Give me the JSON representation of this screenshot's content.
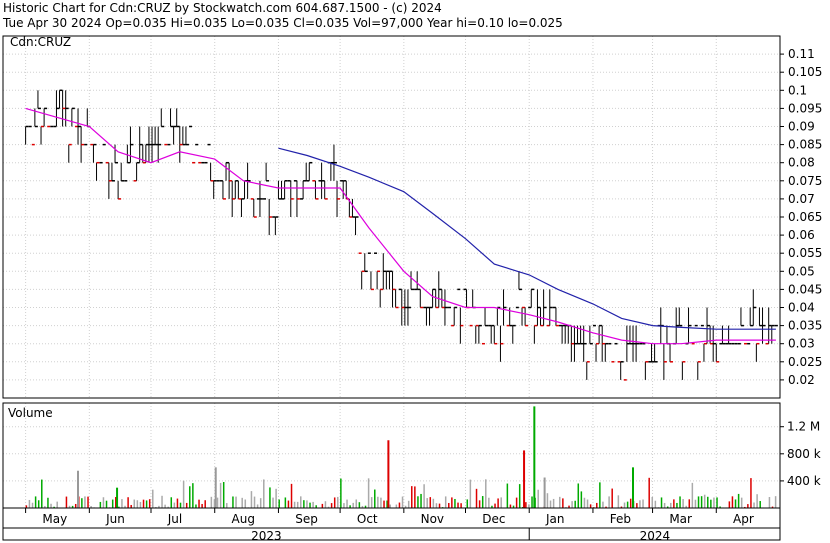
{
  "header": {
    "line1": "Historic Chart for Cdn:CRUZ by Stockwatch.com 604.687.1500 - (c) 2024",
    "line2": "Tue Apr 30 2024  Op=0.035  Hi=0.035  Lo=0.035  Cl=0.035  Vol=97,000  Year hi=0.10  lo=0.025"
  },
  "chart_data": {
    "type": "line",
    "price_panel": {
      "label": "Cdn:CRUZ",
      "ylim": [
        0.015,
        0.115
      ],
      "yticks": [
        "0.11",
        "0.105",
        "0.1",
        "0.095",
        "0.09",
        "0.085",
        "0.08",
        "0.075",
        "0.07",
        "0.065",
        "0.06",
        "0.055",
        "0.05",
        "0.045",
        "0.04",
        "0.035",
        "0.03",
        "0.025",
        "0.02"
      ],
      "close_series": {
        "name": "",
        "x": [
          "2023-05-01",
          "2023-05-15",
          "2023-06-01",
          "2023-06-15",
          "2023-07-01",
          "2023-07-15",
          "2023-08-01",
          "2023-08-15",
          "2023-09-01",
          "2023-09-15",
          "2023-10-01",
          "2023-10-15",
          "2023-11-01",
          "2023-11-15",
          "2023-12-01",
          "2023-12-15",
          "2024-01-01",
          "2024-01-15",
          "2024-02-01",
          "2024-02-15",
          "2024-03-01",
          "2024-03-15",
          "2024-04-01",
          "2024-04-30"
        ],
        "values": [
          0.09,
          0.095,
          0.085,
          0.075,
          0.085,
          0.09,
          0.075,
          0.07,
          0.07,
          0.075,
          0.075,
          0.05,
          0.045,
          0.04,
          0.04,
          0.035,
          0.04,
          0.035,
          0.03,
          0.025,
          0.03,
          0.03,
          0.03,
          0.035
        ]
      },
      "ma_short": {
        "name": "",
        "color": "#dd00dd",
        "x": [
          "2023-05-01",
          "2023-06-01",
          "2023-06-15",
          "2023-07-01",
          "2023-07-15",
          "2023-08-01",
          "2023-08-15",
          "2023-09-01",
          "2023-09-15",
          "2023-10-01",
          "2023-10-15",
          "2023-11-01",
          "2023-11-15",
          "2023-12-01",
          "2023-12-15",
          "2024-01-01",
          "2024-01-15",
          "2024-02-01",
          "2024-02-15",
          "2024-03-01",
          "2024-03-15",
          "2024-04-01",
          "2024-04-30"
        ],
        "values": [
          0.095,
          0.09,
          0.083,
          0.08,
          0.083,
          0.081,
          0.075,
          0.073,
          0.073,
          0.073,
          0.062,
          0.05,
          0.043,
          0.04,
          0.04,
          0.038,
          0.036,
          0.033,
          0.031,
          0.03,
          0.03,
          0.031,
          0.031
        ]
      },
      "ma_long": {
        "name": "",
        "color": "#2222aa",
        "x": [
          "2023-09-01",
          "2023-09-15",
          "2023-10-01",
          "2023-10-15",
          "2023-11-01",
          "2023-11-15",
          "2023-12-01",
          "2023-12-15",
          "2024-01-01",
          "2024-01-15",
          "2024-02-01",
          "2024-02-15",
          "2024-03-01",
          "2024-03-15",
          "2024-04-01",
          "2024-04-30"
        ],
        "values": [
          0.084,
          0.082,
          0.079,
          0.076,
          0.072,
          0.066,
          0.059,
          0.052,
          0.049,
          0.045,
          0.041,
          0.037,
          0.035,
          0.0345,
          0.034,
          0.034
        ]
      }
    },
    "volume_panel": {
      "label": "Volume",
      "ylim": [
        0,
        1550000
      ],
      "yticks": [
        "1.2 M",
        "800 k",
        "400 k"
      ],
      "bars": [
        {
          "x": "2023-10-24",
          "value": 1000000,
          "color": "#dd0000"
        },
        {
          "x": "2023-12-29",
          "value": 850000,
          "color": "#dd0000"
        },
        {
          "x": "2024-01-03",
          "value": 1500000,
          "color": "#00aa00"
        },
        {
          "x": "2024-02-20",
          "value": 600000,
          "color": "#00aa00"
        },
        {
          "x": "2023-08-01",
          "value": 600000,
          "color": "#999999"
        },
        {
          "x": "2023-06-14",
          "value": 300000,
          "color": "#00aa00"
        },
        {
          "x": "2023-05-26",
          "value": 550000,
          "color": "#999999"
        },
        {
          "x": "2024-01-08",
          "value": 450000,
          "color": "#999999"
        }
      ]
    },
    "x_axis": {
      "months": [
        "May",
        "Jun",
        "Jul",
        "Aug",
        "Sep",
        "Oct",
        "Nov",
        "Dec",
        "Jan",
        "Feb",
        "Mar",
        "Apr"
      ],
      "years": [
        "2023",
        "2024"
      ]
    },
    "grid": true
  }
}
